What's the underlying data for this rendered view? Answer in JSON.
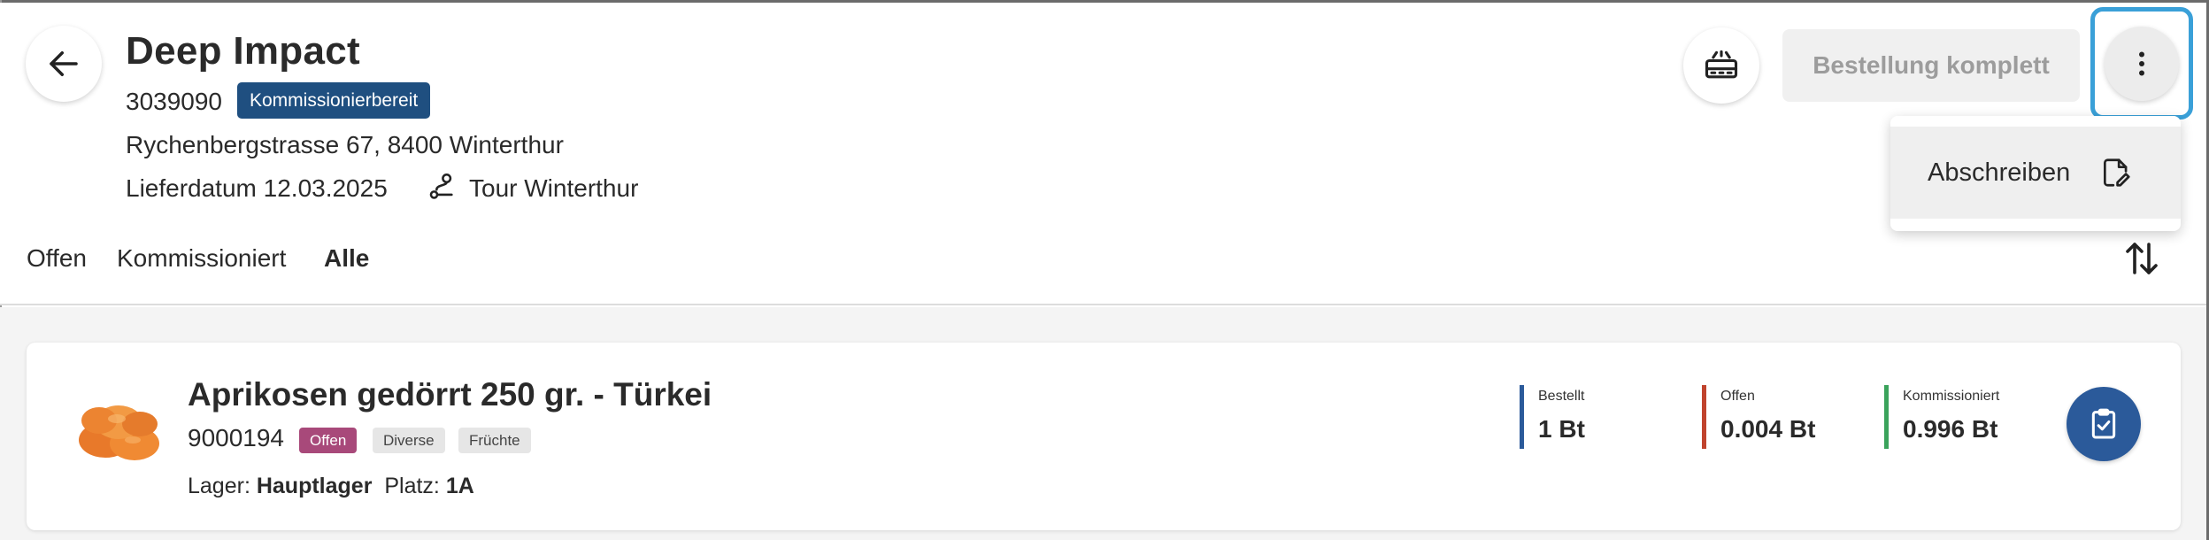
{
  "header": {
    "title": "Deep Impact",
    "order_id": "3039090",
    "status": "Kommissionierbereit",
    "address": "Rychenbergstrasse 67, 8400 Winterthur",
    "delivery_date": "Lieferdatum 12.03.2025",
    "tour": "Tour Winterthur",
    "complete_button": "Bestellung komplett"
  },
  "menu": {
    "items": [
      {
        "label": "Abschreiben",
        "icon": "document-edit-icon"
      }
    ]
  },
  "tabs": [
    {
      "label": "Offen",
      "active": false
    },
    {
      "label": "Kommissioniert",
      "active": false
    },
    {
      "label": "Alle",
      "active": true
    }
  ],
  "items": [
    {
      "name": "Aprikosen gedörrt 250 gr. - Türkei",
      "id": "9000194",
      "status": "Offen",
      "tags": [
        "Diverse",
        "Früchte"
      ],
      "lager_label": "Lager:",
      "lager": "Hauptlager",
      "platz_label": "Platz:",
      "platz": "1A",
      "metrics": [
        {
          "label": "Bestellt",
          "value": "1 Bt",
          "color": "#2b5a9a"
        },
        {
          "label": "Offen",
          "value": "0.004 Bt",
          "color": "#c0432d"
        },
        {
          "label": "Kommissioniert",
          "value": "0.996 Bt",
          "color": "#3aa35b"
        }
      ]
    }
  ],
  "colors": {
    "status_pill": "#1f4f80",
    "badge_offen": "#a8497a",
    "focus_ring": "#3aa0d8",
    "primary": "#2b5a9a"
  }
}
